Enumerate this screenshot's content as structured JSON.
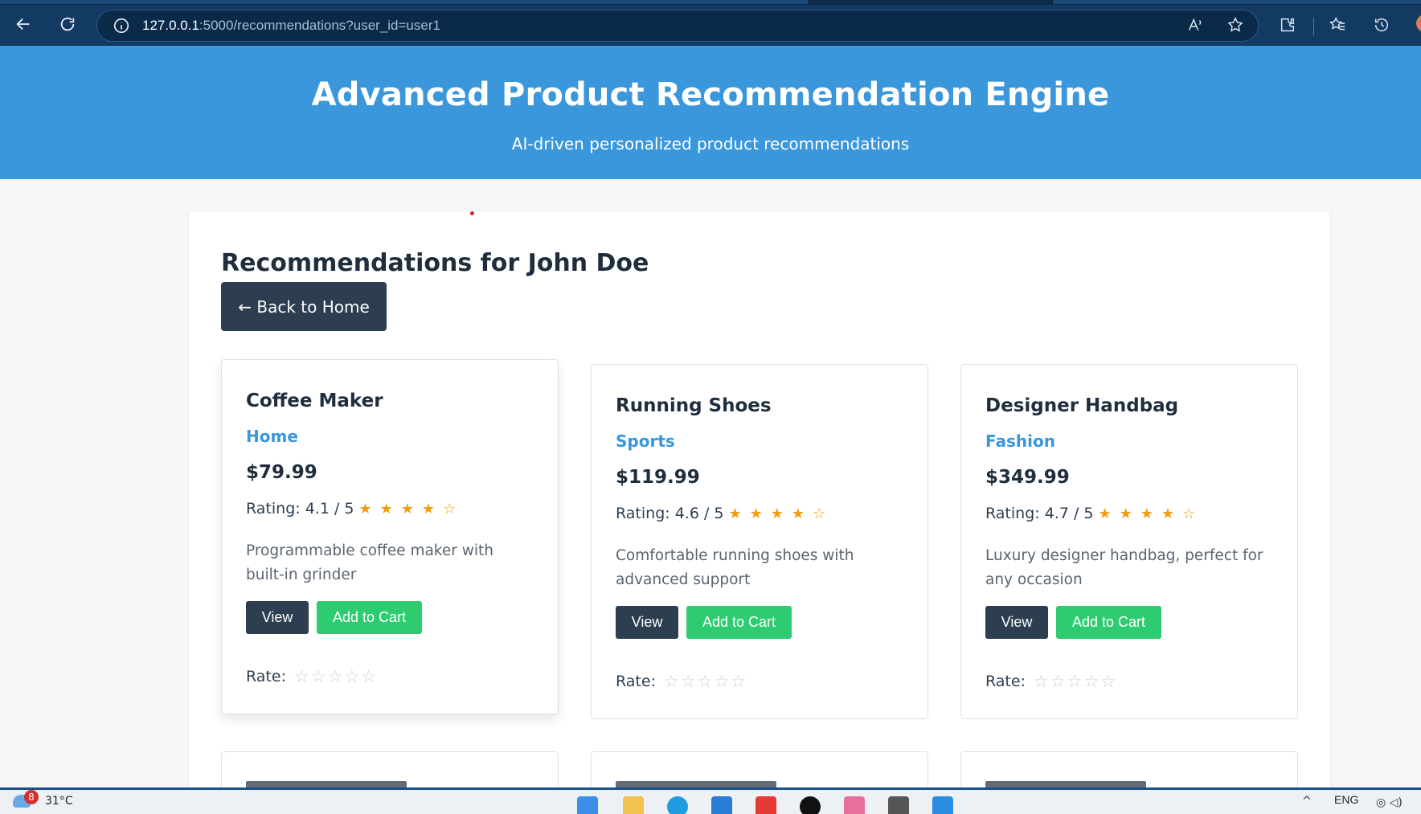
{
  "browser": {
    "url_host": "127.0.0.1",
    "url_rest": ":5000/recommendations?user_id=user1"
  },
  "header": {
    "title": "Advanced Product Recommendation Engine",
    "subtitle": "AI-driven personalized product recommendations"
  },
  "main": {
    "heading": "Recommendations for John Doe",
    "back_label": "← Back to Home",
    "view_label": "View",
    "cart_label": "Add to Cart",
    "rate_label": "Rate:",
    "products": [
      {
        "name": "Coffee Maker",
        "category": "Home",
        "price": "$79.99",
        "rating_text": "Rating: 4.1 / 5",
        "rating_stars": "★★★★☆",
        "description": "Programmable coffee maker with built-in grinder"
      },
      {
        "name": "Running Shoes",
        "category": "Sports",
        "price": "$119.99",
        "rating_text": "Rating: 4.6 / 5",
        "rating_stars": "★★★★☆",
        "description": "Comfortable running shoes with advanced support"
      },
      {
        "name": "Designer Handbag",
        "category": "Fashion",
        "price": "$349.99",
        "rating_text": "Rating: 4.7 / 5",
        "rating_stars": "★★★★☆",
        "description": "Luxury designer handbag, perfect for any occasion"
      }
    ]
  },
  "taskbar": {
    "weather_badge": "8",
    "temperature": "31°C",
    "language": "ENG"
  },
  "colors": {
    "header_bg": "#3a97dc",
    "primary_dark": "#2c3e50",
    "accent_green": "#2ecc71",
    "category_blue": "#3a97dc",
    "star_gold": "#f39c12"
  }
}
